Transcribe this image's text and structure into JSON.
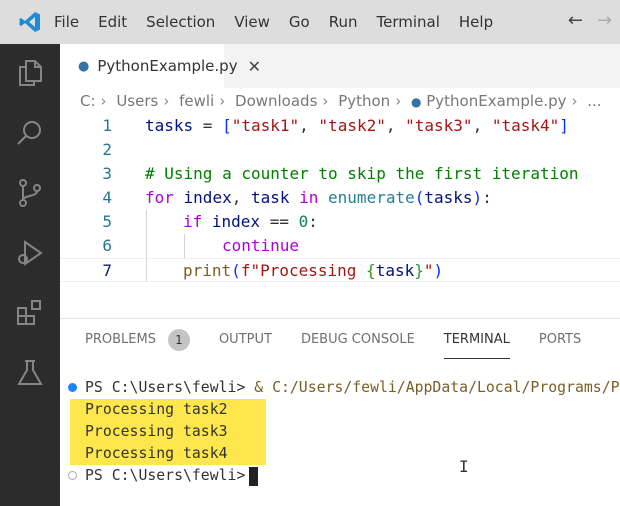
{
  "menu": [
    "File",
    "Edit",
    "Selection",
    "View",
    "Go",
    "Run",
    "Terminal",
    "Help"
  ],
  "nav": {
    "back": "←",
    "forward": "→"
  },
  "tab": {
    "label": "PythonExample.py",
    "close": "✕"
  },
  "breadcrumb": [
    "C:",
    "Users",
    "fewli",
    "Downloads",
    "Python",
    "PythonExample.py",
    "..."
  ],
  "code_lines": [
    "1",
    "2",
    "3",
    "4",
    "5",
    "6",
    "7"
  ],
  "code": {
    "l1": [
      "tasks",
      " = ",
      "[",
      "\"task1\"",
      ", ",
      "\"task2\"",
      ", ",
      "\"task3\"",
      ", ",
      "\"task4\"",
      "]"
    ],
    "l3": "# Using a counter to skip the first iteration",
    "l4": [
      "for",
      " index",
      ", ",
      "task",
      " in ",
      "enumerate",
      "(",
      "tasks",
      ")",
      ":"
    ],
    "l5": [
      "if",
      " index",
      " == ",
      "0",
      ":"
    ],
    "l6": "continue",
    "l7": [
      "print",
      "(",
      "f\"Processing ",
      "{",
      "task",
      "}",
      "\"",
      ")"
    ]
  },
  "panel": {
    "tabs": [
      "PROBLEMS",
      "OUTPUT",
      "DEBUG CONSOLE",
      "TERMINAL",
      "PORTS"
    ],
    "problems_count": "1",
    "active_tab": "TERMINAL"
  },
  "terminal": {
    "prompt": "PS C:\\Users\\fewli> ",
    "command": "& C:/Users/fewli/AppData/Local/Programs/P",
    "output": [
      "Processing task2",
      "Processing task3",
      "Processing task4"
    ],
    "prompt2": "PS C:\\Users\\fewli>"
  },
  "colors": {
    "highlight": "#fde74c",
    "activity_bar": "#2c2c2c",
    "accent": "#007acc"
  }
}
